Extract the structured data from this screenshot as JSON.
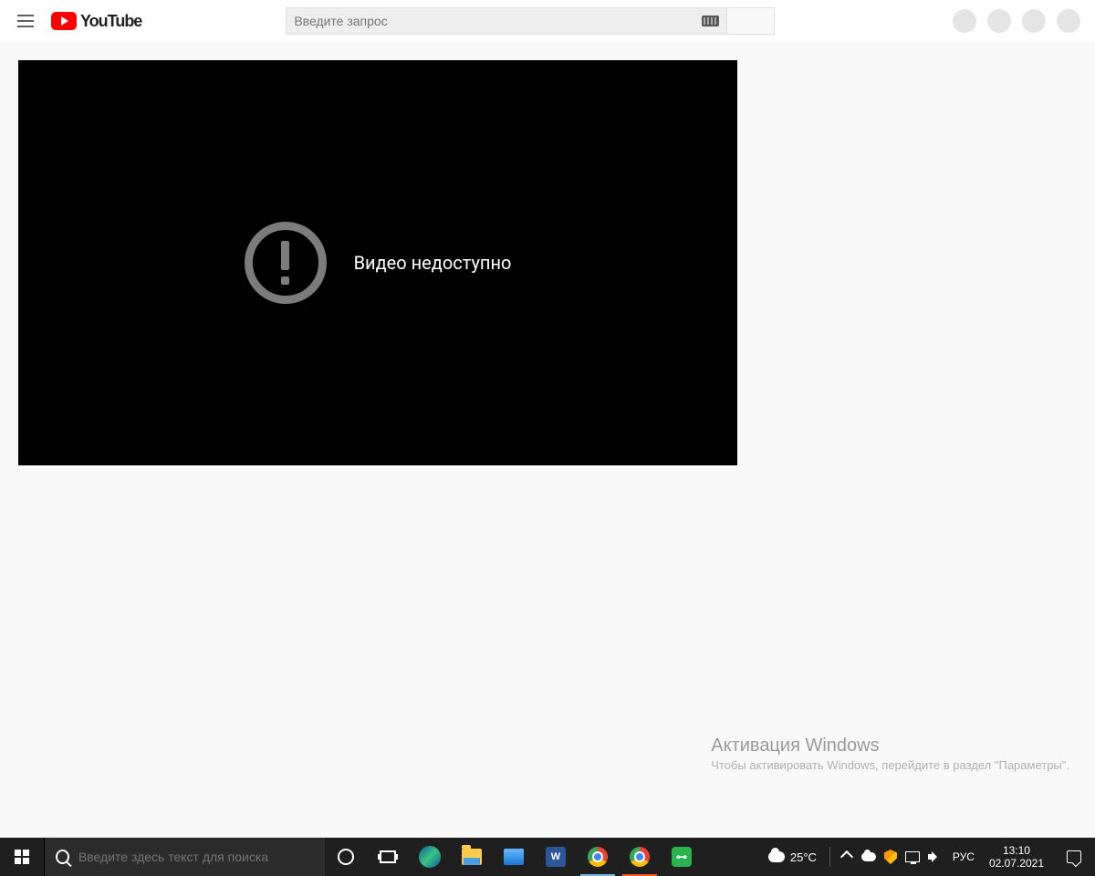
{
  "header": {
    "logo_text": "YouTube",
    "search_placeholder": "Введите запрос"
  },
  "player": {
    "error_message": "Видео недоступно"
  },
  "windows_watermark": {
    "title": "Активация Windows",
    "subtitle": "Чтобы активировать Windows, перейдите в раздел \"Параметры\"."
  },
  "taskbar": {
    "search_placeholder": "Введите здесь текст для поиска",
    "word_letter": "W",
    "vpn_letter": "⊶",
    "weather_temp": "25°C",
    "lang": "РУС",
    "time": "13:10",
    "date": "02.07.2021"
  }
}
